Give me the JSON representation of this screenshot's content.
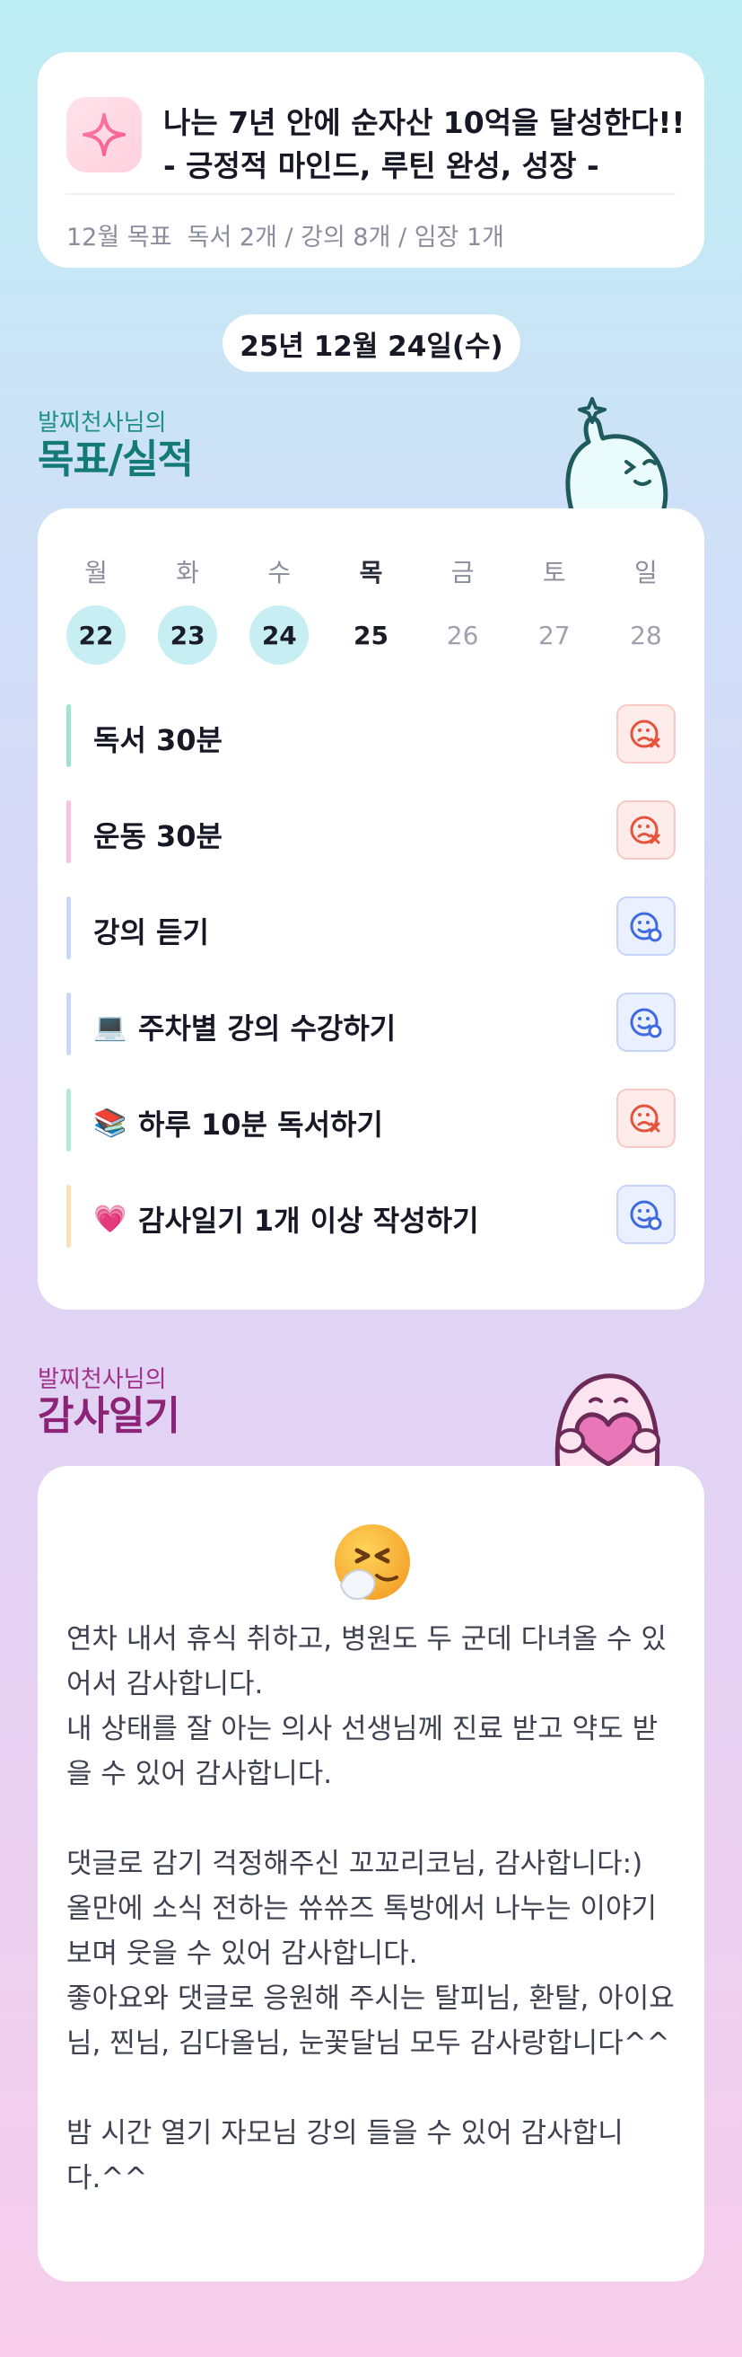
{
  "goal_card": {
    "line1": "나는 7년 안에 순자산 10억을 달성한다!!",
    "line2": "- 긍정적 마인드, 루틴 완성, 성장 -",
    "monthly": "12월 목표  독서 2개 / 강의 8개 / 임장 1개",
    "icon": "sparkle-icon"
  },
  "date": "25년 12월 24일(수)",
  "goals_section": {
    "subtitle": "발찌천사님의",
    "title": "목표/실적"
  },
  "week": [
    {
      "label": "월",
      "num": "22",
      "state": "done"
    },
    {
      "label": "화",
      "num": "23",
      "state": "done"
    },
    {
      "label": "수",
      "num": "24",
      "state": "done"
    },
    {
      "label": "목",
      "num": "25",
      "state": "today"
    },
    {
      "label": "금",
      "num": "26",
      "state": "future"
    },
    {
      "label": "토",
      "num": "27",
      "state": "future"
    },
    {
      "label": "일",
      "num": "28",
      "state": "future"
    }
  ],
  "tasks": [
    {
      "label": "독서 30분",
      "emoji": "",
      "bar_color": "#9fe3d2",
      "status": "fail"
    },
    {
      "label": "운동 30분",
      "emoji": "",
      "bar_color": "#f7c2dc",
      "status": "fail"
    },
    {
      "label": "강의 듣기",
      "emoji": "",
      "bar_color": "#c9d8f6",
      "status": "ok"
    },
    {
      "label": "주차별 강의 수강하기",
      "emoji": "💻",
      "bar_color": "#c9d8f6",
      "status": "ok"
    },
    {
      "label": "하루 10분 독서하기",
      "emoji": "📚",
      "bar_color": "#b4ead6",
      "status": "fail"
    },
    {
      "label": "감사일기 1개 이상 작성하기",
      "emoji": "💗",
      "bar_color": "#fbe0b8",
      "status": "ok"
    }
  ],
  "status_colors": {
    "fail": "#e5533d",
    "ok": "#3f6ae0"
  },
  "gratitude_section": {
    "subtitle": "발찌천사님의",
    "title": "감사일기",
    "mood_icon": "sneezing-face-icon",
    "text": "연차 내서 휴식 취하고, 병원도 두 군데 다녀올 수 있어서 감사합니다.\n내 상태를 잘 아는 의사 선생님께 진료 받고 약도 받을 수 있어 감사합니다.\n\n댓글로 감기 걱정해주신 꼬꼬리코님, 감사합니다:)\n올만에 소식 전하는 쓔쓔즈 톡방에서 나누는 이야기 보며 웃을 수 있어 감사합니다.\n좋아요와 댓글로 응원해 주시는 탈피님, 환탈, 아이요님, 찐님, 김다올님, 눈꽃달님 모두 감사랑합니다^^\n\n밤 시간 열기 자모님 강의 들을 수 있어 감사합니다.^^"
  }
}
